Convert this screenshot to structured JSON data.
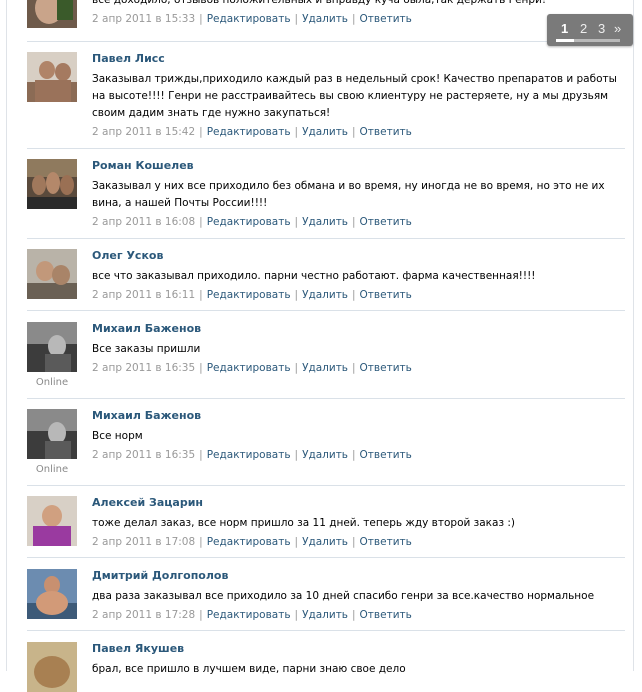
{
  "actions": {
    "edit": "Редактировать",
    "delete": "Удалить",
    "reply": "Ответить"
  },
  "pager": {
    "pages": [
      "1",
      "2",
      "3"
    ],
    "current": "1",
    "next": "»"
  },
  "posts": [
    {
      "author": "",
      "text": "все доходило, отзывов положительных и вправду куча была,так держать Генри!",
      "date": "2 апр 2011 в 15:33",
      "online": ""
    },
    {
      "author": "Павел Лисс",
      "text": "Заказывал трижды,приходило каждый раз в недельный срок! Качество препаратов и работы на высоте!!!! Генри не расстраивайтесь вы свою клиентуру не растеряете, ну а мы друзьям своим дадим знать где нужно закупаться!",
      "date": "2 апр 2011 в 15:42",
      "online": ""
    },
    {
      "author": "Роман Кошелев",
      "text": "Заказывал у них все приходило без обмана и во время, ну иногда не во время, но это не их вина, а нашей Почты России!!!!",
      "date": "2 апр 2011 в 16:08",
      "online": ""
    },
    {
      "author": "Олег Усков",
      "text": "все что заказывал приходило. парни честно работают. фарма качественная!!!!",
      "date": "2 апр 2011 в 16:11",
      "online": ""
    },
    {
      "author": "Михаил Баженов",
      "text": "Все заказы пришли",
      "date": "2 апр 2011 в 16:35",
      "online": "Online"
    },
    {
      "author": "Михаил Баженов",
      "text": "Все норм",
      "date": "2 апр 2011 в 16:35",
      "online": "Online"
    },
    {
      "author": "Алексей Зацарин",
      "text": "тоже делал заказ, все норм пришло за 11 дней. теперь жду второй заказ :)",
      "date": "2 апр 2011 в 17:08",
      "online": ""
    },
    {
      "author": "Дмитрий Долгополов",
      "text": "два раза заказывал все приходило за 10 дней спасибо генри за все.качество нормальное",
      "date": "2 апр 2011 в 17:28",
      "online": ""
    },
    {
      "author": "Павел Якушев",
      "text": "брал, все пришло в лучшем виде, парни знаю свое дело",
      "date": "",
      "online": ""
    }
  ]
}
